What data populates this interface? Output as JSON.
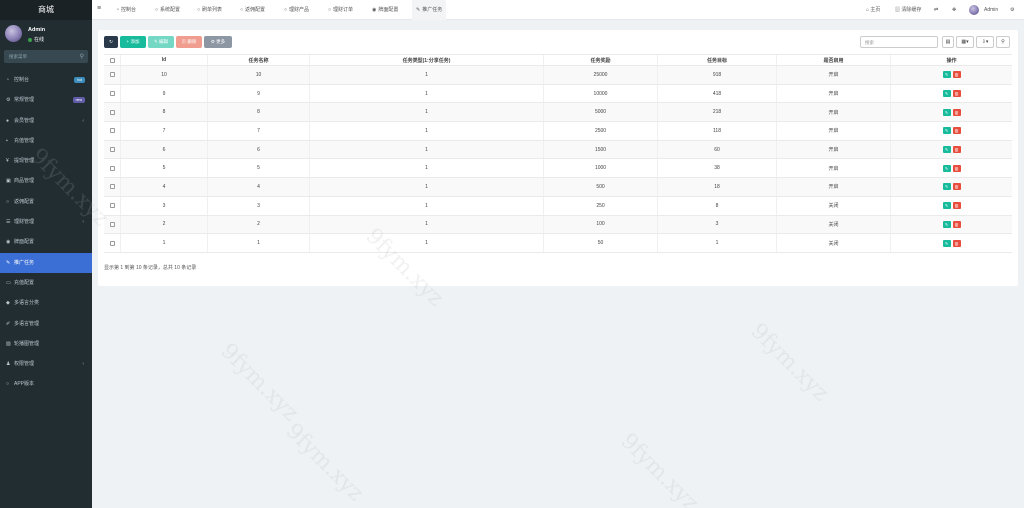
{
  "brand": "商城",
  "user": {
    "name": "Admin",
    "status": "在线"
  },
  "sidebar": {
    "search_placeholder": "搜索菜单",
    "items": [
      {
        "label": "控制台",
        "icon": "dashboard-icon",
        "badge": "hot"
      },
      {
        "label": "常规管理",
        "icon": "gear-icon",
        "badge": "new"
      },
      {
        "label": "会员管理",
        "icon": "user-icon",
        "chevron": true
      },
      {
        "label": "充值管理",
        "icon": "wallet-icon"
      },
      {
        "label": "提现管理",
        "icon": "yen-icon"
      },
      {
        "label": "商品管理",
        "icon": "cart-icon"
      },
      {
        "label": "返佣配置",
        "icon": "circle-icon"
      },
      {
        "label": "理财管理",
        "icon": "list-icon",
        "chevron": true
      },
      {
        "label": "牌面配置",
        "icon": "disc-icon"
      },
      {
        "label": "推广任务",
        "icon": "pencil-icon",
        "active": true
      },
      {
        "label": "充值配置",
        "icon": "card-icon"
      },
      {
        "label": "多语言分类",
        "icon": "tag-icon"
      },
      {
        "label": "多语言管理",
        "icon": "edit-icon"
      },
      {
        "label": "轮播图管理",
        "icon": "image-icon"
      },
      {
        "label": "权限管理",
        "icon": "users-icon",
        "chevron": true
      },
      {
        "label": "APP版本",
        "icon": "circle-icon"
      }
    ]
  },
  "topbar": {
    "tabs": [
      {
        "label": "控制台",
        "icon": "dashboard-icon"
      },
      {
        "label": "系统配置",
        "icon": "circle-icon"
      },
      {
        "label": "刷单列表",
        "icon": "circle-icon"
      },
      {
        "label": "返佣配置",
        "icon": "circle-icon"
      },
      {
        "label": "理财产品",
        "icon": "circle-icon"
      },
      {
        "label": "理财订单",
        "icon": "circle-icon"
      },
      {
        "label": "牌面配置",
        "icon": "disc-icon"
      },
      {
        "label": "推广任务",
        "icon": "pencil-icon",
        "active": true
      }
    ],
    "home": "主页",
    "clear_cache": "清除缓存",
    "admin": "Admin"
  },
  "toolbar": {
    "add": "添加",
    "edit": "编辑",
    "delete": "删除",
    "more": "更多",
    "search_placeholder": "搜索"
  },
  "table": {
    "columns": [
      "Id",
      "任务名称",
      "任务类型(1:分享任务)",
      "任务奖励",
      "任务目标",
      "是否启用",
      "操作"
    ],
    "rows": [
      {
        "id": "10",
        "name": "10",
        "type": "1",
        "reward": "25000",
        "target": "918",
        "enabled": "开启"
      },
      {
        "id": "9",
        "name": "9",
        "type": "1",
        "reward": "10000",
        "target": "418",
        "enabled": "开启"
      },
      {
        "id": "8",
        "name": "8",
        "type": "1",
        "reward": "5000",
        "target": "218",
        "enabled": "开启"
      },
      {
        "id": "7",
        "name": "7",
        "type": "1",
        "reward": "2500",
        "target": "118",
        "enabled": "开启"
      },
      {
        "id": "6",
        "name": "6",
        "type": "1",
        "reward": "1500",
        "target": "60",
        "enabled": "开启"
      },
      {
        "id": "5",
        "name": "5",
        "type": "1",
        "reward": "1000",
        "target": "38",
        "enabled": "开启"
      },
      {
        "id": "4",
        "name": "4",
        "type": "1",
        "reward": "500",
        "target": "18",
        "enabled": "开启"
      },
      {
        "id": "3",
        "name": "3",
        "type": "1",
        "reward": "250",
        "target": "8",
        "enabled": "关闭"
      },
      {
        "id": "2",
        "name": "2",
        "type": "1",
        "reward": "100",
        "target": "3",
        "enabled": "关闭"
      },
      {
        "id": "1",
        "name": "1",
        "type": "1",
        "reward": "50",
        "target": "1",
        "enabled": "关闭"
      }
    ],
    "summary": "显示第 1 到第 10 条记录，总共 10 条记录"
  },
  "watermark": "9fym.xyz",
  "colors": {
    "sidebar": "#222d32",
    "active": "#3c6fd6",
    "add": "#18bc9c",
    "delete": "#e74c3c"
  }
}
